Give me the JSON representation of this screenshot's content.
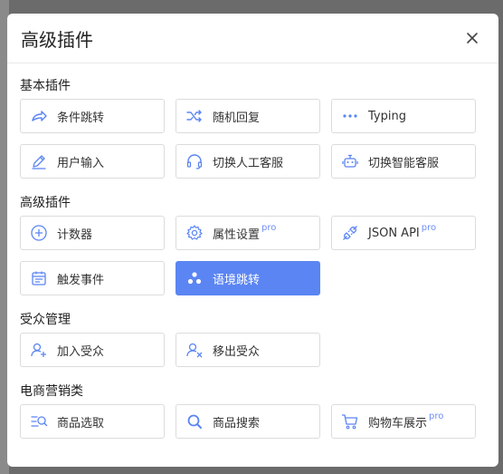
{
  "modal": {
    "title": "高级插件"
  },
  "sections": [
    {
      "title": "基本插件",
      "items": [
        {
          "label": "条件跳转",
          "icon": "share-arrow-icon"
        },
        {
          "label": "随机回复",
          "icon": "shuffle-icon"
        },
        {
          "label": "Typing",
          "icon": "dots-icon"
        },
        {
          "label": "用户输入",
          "icon": "pencil-icon"
        },
        {
          "label": "切换人工客服",
          "icon": "headset-icon"
        },
        {
          "label": "切换智能客服",
          "icon": "robot-icon"
        }
      ]
    },
    {
      "title": "高级插件",
      "items": [
        {
          "label": "计数器",
          "icon": "plus-circle-icon"
        },
        {
          "label": "属性设置",
          "icon": "gear-icon",
          "badge": "pro"
        },
        {
          "label": "JSON API",
          "icon": "plug-icon",
          "badge": "pro"
        },
        {
          "label": "触发事件",
          "icon": "calendar-icon"
        },
        {
          "label": "语境跳转",
          "icon": "three-dots-icon",
          "active": true
        }
      ]
    },
    {
      "title": "受众管理",
      "items": [
        {
          "label": "加入受众",
          "icon": "user-add-icon"
        },
        {
          "label": "移出受众",
          "icon": "user-remove-icon"
        }
      ]
    },
    {
      "title": "电商营销类",
      "items": [
        {
          "label": "商品选取",
          "icon": "list-search-icon"
        },
        {
          "label": "商品搜索",
          "icon": "search-icon"
        },
        {
          "label": "购物车展示",
          "icon": "cart-icon",
          "badge": "pro"
        }
      ]
    }
  ]
}
